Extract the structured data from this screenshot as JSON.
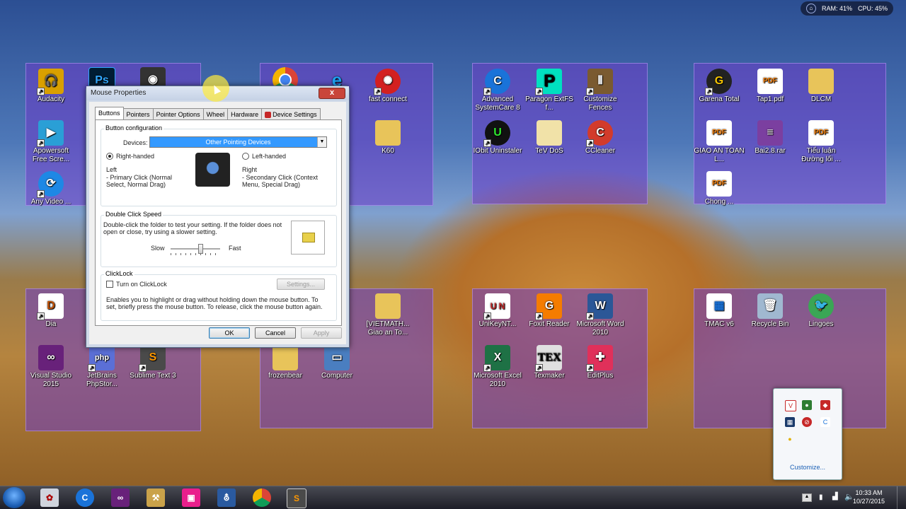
{
  "system_meter": {
    "ram": "RAM: 41%",
    "cpu": "CPU: 45%"
  },
  "fences": [
    {
      "icons": [
        {
          "label": "Audacity",
          "icon": "audacity-icon",
          "color": "#d9a000"
        },
        {
          "label": "Apowersoft Free Scre...",
          "icon": "apowersoft-icon",
          "color": "#2a9fd6"
        },
        {
          "label": "Any Video ...",
          "icon": "any-video-icon",
          "color": "#1e88e5"
        },
        {
          "label": "Dia",
          "icon": "dia-icon",
          "color": "#ffffff"
        },
        {
          "label": "Visual Studio 2015",
          "icon": "visual-studio-icon",
          "color": "#68217a"
        },
        {
          "label": "JetBrains PhpStor...",
          "icon": "phpstorm-icon",
          "color": "#5b6fd6"
        },
        {
          "label": "Sublime Text 3",
          "icon": "sublime-icon",
          "color": "#4a4a4a"
        }
      ]
    },
    {
      "icons": [
        {
          "label": "fast connect",
          "icon": "fast-connect-icon",
          "color": "#d32020"
        },
        {
          "label": "K60",
          "icon": "folder-icon",
          "color": "#e8c45a"
        },
        {
          "label": "[VIETMATH... Giao an To...",
          "icon": "folder-icon",
          "color": "#e8c45a"
        },
        {
          "label": "frozenbear",
          "icon": "user-folder-icon",
          "color": "#e8c45a"
        },
        {
          "label": "Computer",
          "icon": "computer-icon",
          "color": "#4a7ec0"
        }
      ]
    },
    {
      "icons": [
        {
          "label": "Advanced SystemCare 8",
          "icon": "systemcare-icon",
          "color": "#1a73d9"
        },
        {
          "label": "Paragon ExtFS f...",
          "icon": "paragon-icon",
          "color": "#000000"
        },
        {
          "label": "Customize Fences",
          "icon": "fences-icon",
          "color": "#7a5a30"
        },
        {
          "label": "IObit Uninstaler",
          "icon": "iobit-icon",
          "color": "#2ea82e"
        },
        {
          "label": "TeV DoS",
          "icon": "folder-icon",
          "color": "#e8c45a"
        },
        {
          "label": "CCleaner",
          "icon": "ccleaner-icon",
          "color": "#d23b2b"
        },
        {
          "label": "UniKeyNT...",
          "icon": "unikey-icon",
          "color": "#c62828"
        },
        {
          "label": "Foxit Reader",
          "icon": "foxit-icon",
          "color": "#f57c00"
        },
        {
          "label": "Microsoft Word 2010",
          "icon": "word-icon",
          "color": "#2b5797"
        },
        {
          "label": "Microsoft Excel 2010",
          "icon": "excel-icon",
          "color": "#1e7145"
        },
        {
          "label": "Texmaker",
          "icon": "texmaker-icon",
          "color": "#e0e0e0"
        },
        {
          "label": "EditPlus",
          "icon": "editplus-icon",
          "color": "#e0305a"
        }
      ]
    },
    {
      "icons": [
        {
          "label": "Garena Total",
          "icon": "garena-icon",
          "color": "#222222"
        },
        {
          "label": "Tap1.pdf",
          "icon": "pdf-file-icon",
          "color": "#ffffff"
        },
        {
          "label": "DLCM",
          "icon": "folder-icon",
          "color": "#e8c45a"
        },
        {
          "label": "GIAO AN TOAN L...",
          "icon": "pdf-file-icon",
          "color": "#ffffff"
        },
        {
          "label": "Bai2.8.rar",
          "icon": "rar-icon",
          "color": "#7b3fa0"
        },
        {
          "label": "Tiểu luận Đường lối ...",
          "icon": "pdf-file-icon",
          "color": "#ffffff"
        },
        {
          "label": "Chong ...",
          "icon": "pdf-file-icon",
          "color": "#ffffff"
        },
        {
          "label": "TMAC v6",
          "icon": "tmac-icon",
          "color": "#1a73d9"
        },
        {
          "label": "Recycle Bin",
          "icon": "recycle-bin-icon",
          "color": "#a0b8d0"
        },
        {
          "label": "Lingoes",
          "icon": "lingoes-icon",
          "color": "#3aa655"
        }
      ]
    }
  ],
  "dialog": {
    "title": "Mouse Properties",
    "close": "x",
    "tabs": [
      "Buttons",
      "Pointers",
      "Pointer Options",
      "Wheel",
      "Hardware",
      "Device Settings"
    ],
    "button_config": {
      "legend": "Button configuration",
      "devices_label": "Devices:",
      "devices_value": "Other Pointing Devices",
      "right_handed": "Right-handed",
      "left_handed": "Left-handed",
      "left_title": "Left",
      "left_desc": "- Primary Click (Normal Select, Normal Drag)",
      "right_title": "Right",
      "right_desc": "- Secondary Click (Context Menu, Special Drag)"
    },
    "double_click": {
      "legend": "Double Click Speed",
      "desc": "Double-click the folder to test your setting.  If the folder does not open or close, try using a slower setting.",
      "slow": "Slow",
      "fast": "Fast",
      "speed_fraction": 0.6
    },
    "clicklock": {
      "legend": "ClickLock",
      "checkbox": "Turn on ClickLock",
      "settings": "Settings...",
      "desc": "Enables you to highlight or drag without holding down the mouse button.  To set, briefly press the mouse button.  To release, click the mouse button again."
    },
    "buttons": {
      "ok": "OK",
      "cancel": "Cancel",
      "apply": "Apply"
    }
  },
  "tray_popup": {
    "customize": "Customize..."
  },
  "taskbar": {
    "time": "10:33 AM",
    "date": "10/27/2015"
  }
}
